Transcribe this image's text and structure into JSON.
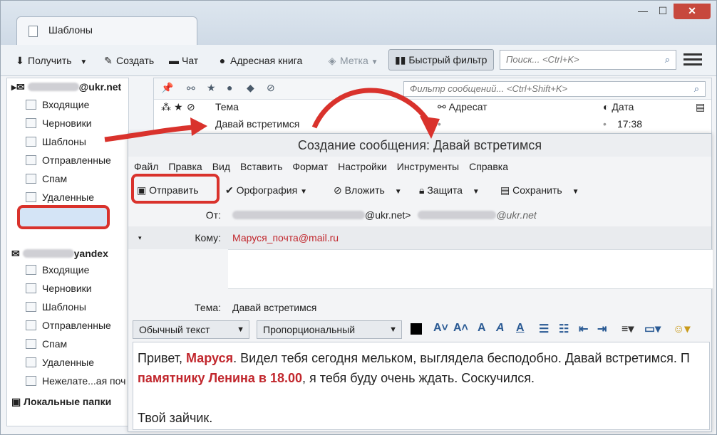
{
  "window": {
    "tab_label": "Шаблоны",
    "minimize": "—",
    "maximize": "☐",
    "close": "✕"
  },
  "toolbar": {
    "get_mail": "Получить",
    "write": "Создать",
    "chat": "Чат",
    "address_book": "Адресная книга",
    "tag": "Метка",
    "quick_filter": "Быстрый фильтр",
    "search_placeholder": "Поиск... <Ctrl+K>"
  },
  "sidebar": {
    "account1": "@ukr.net",
    "account1_items": [
      {
        "label": "Входящие",
        "icon": "inbox-icon"
      },
      {
        "label": "Черновики",
        "icon": "drafts-icon"
      },
      {
        "label": "Шаблоны",
        "icon": "templates-icon"
      },
      {
        "label": "Отправленные",
        "icon": "sent-icon"
      },
      {
        "label": "Спам",
        "icon": "spam-icon"
      },
      {
        "label": "Удаленные",
        "icon": "trash-icon"
      }
    ],
    "account2": "yandex",
    "account2_items": [
      {
        "label": "Входящие",
        "icon": "inbox-icon"
      },
      {
        "label": "Черновики",
        "icon": "drafts-icon"
      },
      {
        "label": "Шаблоны",
        "icon": "templates-icon"
      },
      {
        "label": "Отправленные",
        "icon": "sent-icon"
      },
      {
        "label": "Спам",
        "icon": "spam-icon"
      },
      {
        "label": "Удаленные",
        "icon": "trash-icon"
      },
      {
        "label": "Нежелате...ая поч",
        "icon": "junk-icon"
      }
    ],
    "local_folders": "Локальные папки"
  },
  "message_list": {
    "filter_placeholder": "Фильтр сообщений... <Ctrl+Shift+K>",
    "columns": {
      "subject": "Тема",
      "recipient": "Адресат",
      "date": "Дата"
    },
    "rows": [
      {
        "subject": "Давай встретимся",
        "recipient": "•",
        "date": "17:38"
      }
    ]
  },
  "compose": {
    "title": "Создание сообщения: Давай встретимся",
    "menu": [
      "Файл",
      "Правка",
      "Вид",
      "Вставить",
      "Формат",
      "Настройки",
      "Инструменты",
      "Справка"
    ],
    "toolbar": {
      "send": "Отправить",
      "spelling": "Орфография",
      "attach": "Вложить",
      "security": "Защита",
      "save": "Сохранить"
    },
    "from_label": "От:",
    "from_value": "@ukr.net>",
    "from_value2": "@ukr.net",
    "to_label": "Кому:",
    "to_value": "Маруся_почта@mail.ru",
    "subject_label": "Тема:",
    "subject_value": "Давай встретимся",
    "format_paragraph": "Обычный текст",
    "format_font": "Пропорциональный",
    "body": {
      "line1_a": "Привет, ",
      "line1_name": "Маруся",
      "line1_b": ". Видел тебя сегодня мельком, выглядела бесподобно. Давай встретимся. П",
      "line2_bold": "памятнику Ленина в 18.00",
      "line2_b": ", я тебя буду очень ждать. Соскучился.",
      "line4": "Твой зайчик."
    }
  },
  "colors": {
    "highlight": "#d9322c",
    "to_address": "#c1272d"
  }
}
